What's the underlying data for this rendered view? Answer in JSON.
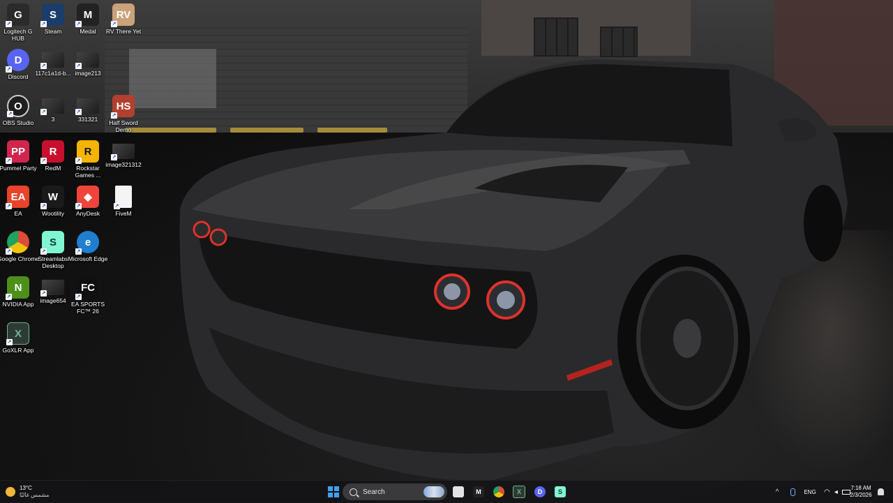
{
  "desktop": {
    "icons": [
      {
        "label": "Logitech G HUB",
        "icon": "logitech-g-icon",
        "color": "#2b2b2b",
        "glyph": "G"
      },
      {
        "label": "Steam",
        "icon": "steam-icon",
        "color": "#1b3d6b",
        "glyph": "S"
      },
      {
        "label": "Medal",
        "icon": "medal-icon",
        "color": "#222222",
        "glyph": "M"
      },
      {
        "label": "RV There Yet",
        "icon": "rv-there-yet-icon",
        "color": "#c9a27a",
        "glyph": "RV"
      },
      {
        "label": "Discord",
        "icon": "discord-icon",
        "color": "#5865f2",
        "glyph": "D"
      },
      {
        "label": "117c1a1d-b...",
        "icon": "image-file-icon",
        "color": "#333333",
        "glyph": ""
      },
      {
        "label": "image213",
        "icon": "image-file-icon",
        "color": "#333333",
        "glyph": ""
      },
      {
        "label": "OBS Studio",
        "icon": "obs-icon",
        "color": "#1e1e1e",
        "glyph": "O"
      },
      {
        "label": "3",
        "icon": "image-file-icon",
        "color": "#333333",
        "glyph": ""
      },
      {
        "label": "331321",
        "icon": "image-file-icon",
        "color": "#333333",
        "glyph": ""
      },
      {
        "label": "Half Sword Demo",
        "icon": "half-sword-icon",
        "color": "#b3402f",
        "glyph": "HS"
      },
      {
        "label": "Pummel Party",
        "icon": "pummel-party-icon",
        "color": "#d0264d",
        "glyph": "PP"
      },
      {
        "label": "RedM",
        "icon": "redm-icon",
        "color": "#c8102e",
        "glyph": "R"
      },
      {
        "label": "Rockstar Games ...",
        "icon": "rockstar-icon",
        "color": "#f5b400",
        "glyph": "R"
      },
      {
        "label": "image321312",
        "icon": "image-file-icon",
        "color": "#333333",
        "glyph": ""
      },
      {
        "label": "EA",
        "icon": "ea-icon",
        "color": "#e8432b",
        "glyph": "EA"
      },
      {
        "label": "Wootility",
        "icon": "wootility-icon",
        "color": "#1a1a1a",
        "glyph": "W"
      },
      {
        "label": "AnyDesk",
        "icon": "anydesk-icon",
        "color": "#ef443b",
        "glyph": "◆"
      },
      {
        "label": "FiveM",
        "icon": "fivem-icon",
        "color": "#f4f4f4",
        "glyph": ""
      },
      {
        "label": "Google Chrome",
        "icon": "chrome-icon",
        "color": "#dd4b39",
        "glyph": ""
      },
      {
        "label": "Streamlabs Desktop",
        "icon": "streamlabs-icon",
        "color": "#80f5d2",
        "glyph": "S"
      },
      {
        "label": "Microsoft Edge",
        "icon": "edge-icon",
        "color": "#1e7fd0",
        "glyph": "e"
      },
      {
        "label": "NVIDIA App",
        "icon": "nvidia-icon",
        "color": "#4d8f1a",
        "glyph": "N"
      },
      {
        "label": "image654",
        "icon": "image-file-icon",
        "color": "#333333",
        "glyph": ""
      },
      {
        "label": "EA SPORTS FC™ 26",
        "icon": "ea-sports-fc-icon",
        "color": "#101010",
        "glyph": "FC"
      },
      {
        "label": "GoXLR App",
        "icon": "goxlr-icon",
        "color": "#2d3b34",
        "glyph": "X"
      }
    ]
  },
  "taskbar": {
    "search_label": "Search",
    "apps": [
      {
        "icon": "file-explorer-icon",
        "color": "#e3e3e3",
        "glyph": ""
      },
      {
        "icon": "medal-icon",
        "color": "#222222",
        "glyph": "M"
      },
      {
        "icon": "chrome-icon",
        "color": "#dd4b39",
        "glyph": ""
      },
      {
        "icon": "goxlr-icon",
        "color": "#2d3b34",
        "glyph": "X"
      },
      {
        "icon": "discord-icon",
        "color": "#5865f2",
        "glyph": "D"
      },
      {
        "icon": "streamlabs-icon",
        "color": "#80f5d2",
        "glyph": "S"
      }
    ],
    "weather": {
      "temp": "13°C",
      "desc": "مشمس غالبًا"
    },
    "tray": {
      "language": "ENG",
      "time": "7:18 AM",
      "date": "2/3/2026"
    }
  }
}
